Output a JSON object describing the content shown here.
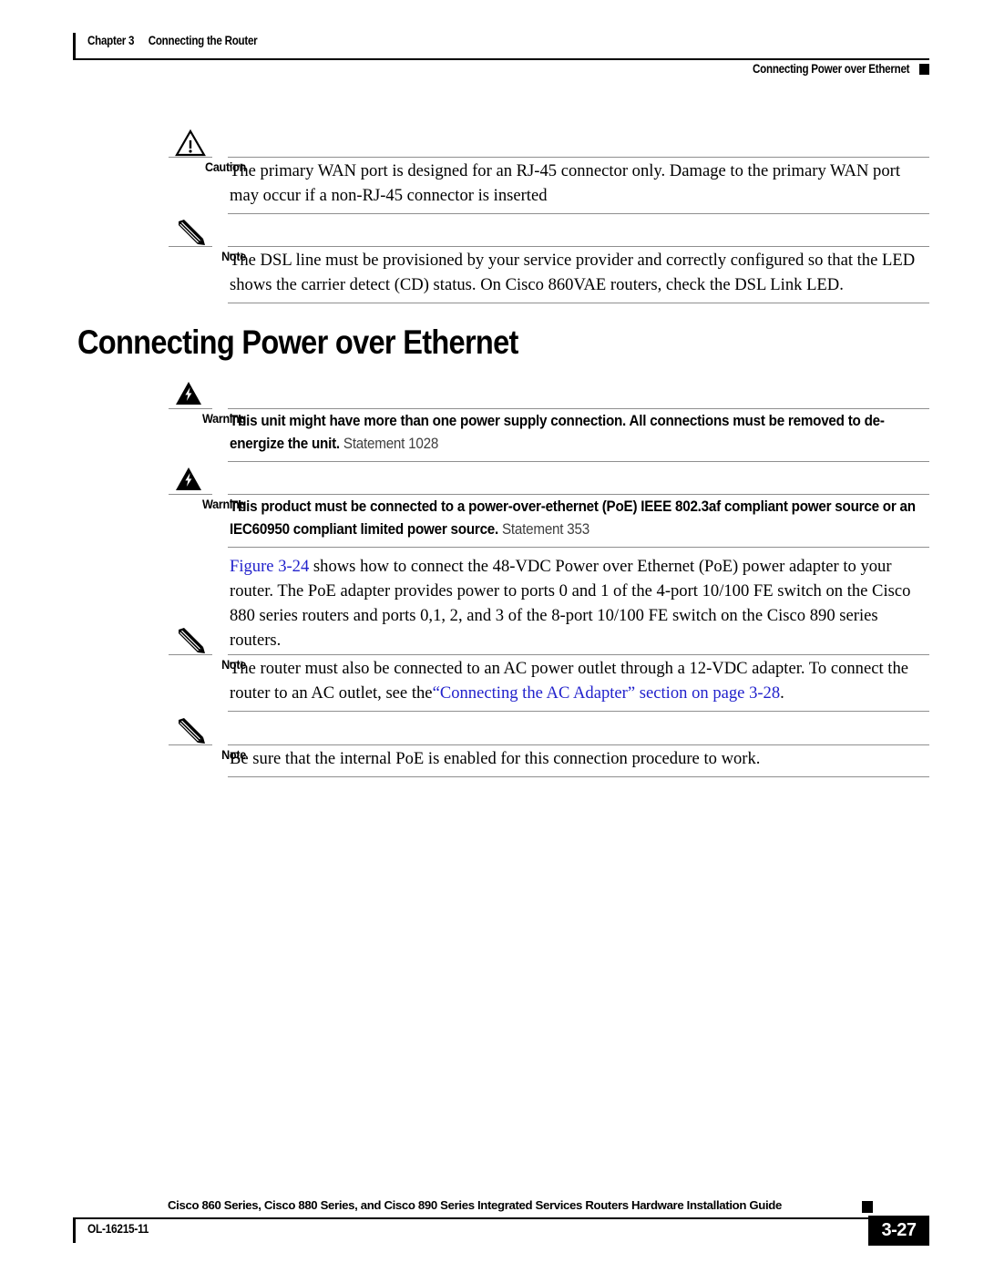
{
  "header": {
    "chapter_number": "Chapter 3",
    "chapter_title": "Connecting the Router",
    "running_head": "Connecting Power over Ethernet"
  },
  "section": {
    "heading": "Connecting Power over Ethernet"
  },
  "admonitions": [
    {
      "icon": "caution-triangle-icon",
      "label": "Caution",
      "text": "The primary WAN port is designed for an RJ-45 connector only. Damage to the primary WAN port may occur if a non-RJ-45 connector is inserted"
    },
    {
      "icon": "note-pencil-icon",
      "label": "Note",
      "text": "The DSL line must be provisioned by your service provider and correctly configured so that the LED shows the carrier detect (CD) status. On Cisco 860VAE routers, check the DSL Link LED."
    },
    {
      "icon": "warning-lightning-icon",
      "label": "Warning",
      "text": "This unit might have more than one power supply connection. All connections must be removed to de-energize the unit.",
      "statement": " Statement 1028"
    },
    {
      "icon": "warning-lightning-icon",
      "label": "Warning",
      "text": "This product must be connected to a power-over-ethernet (PoE) IEEE 802.3af compliant power source or an IEC60950 compliant limited power source.",
      "statement": " Statement 353"
    },
    {
      "icon": "note-pencil-icon",
      "label": "Note",
      "text_before_link": "The router must also be connected to an AC power outlet through a 12-VDC adapter. To connect the router to an AC outlet, see the",
      "link_text": "“Connecting the AC Adapter” section on page 3-28",
      "text_after_link": "."
    },
    {
      "icon": "note-pencil-icon",
      "label": "Note",
      "text": "Be sure that the internal PoE is enabled for this connection procedure to work."
    }
  ],
  "paragraph": {
    "link_text": "Figure 3-24",
    "text_after_link": " shows how to connect the 48-VDC Power over Ethernet (PoE) power adapter to your router. The PoE adapter provides power to ports 0 and 1 of the 4-port 10/100 FE switch on the Cisco 880 series routers and ports 0,1, 2, and 3 of the 8-port 10/100 FE switch on the Cisco 890 series routers."
  },
  "footer": {
    "title": "Cisco 860 Series, Cisco 880 Series, and Cisco 890 Series Integrated Services Routers Hardware Installation Guide",
    "doc_id": "OL-16215-11",
    "page_number": "3-27"
  },
  "colors": {
    "link": "#2222CC",
    "rule": "#8F8F8F",
    "text": "#000000"
  }
}
